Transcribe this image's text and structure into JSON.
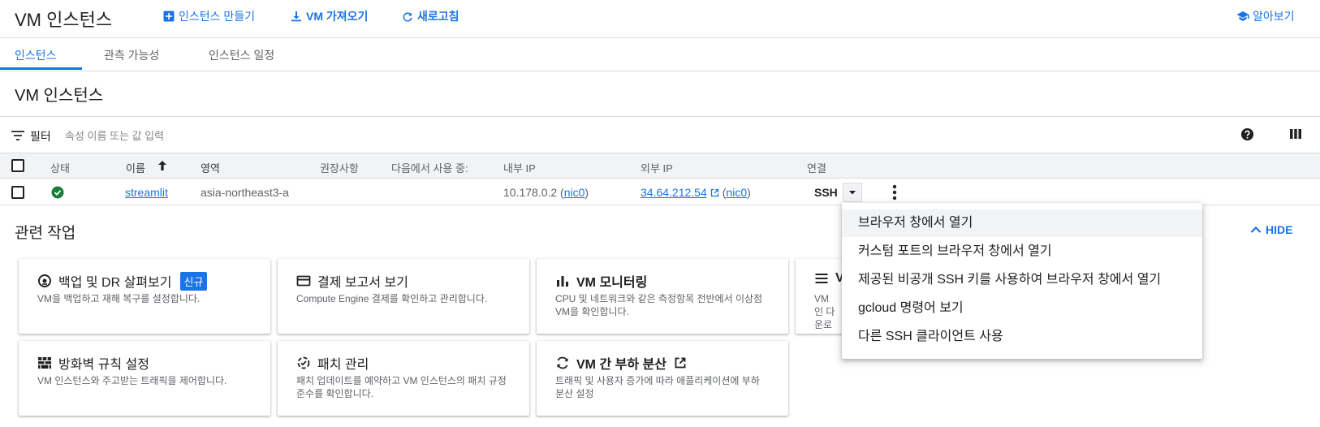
{
  "header": {
    "title": "VM 인스턴스",
    "create_label": "인스턴스 만들기",
    "import_label": "VM 가져오기",
    "refresh_label": "새로고침",
    "learn_label": "알아보기"
  },
  "tabs": [
    {
      "label": "인스턴스",
      "active": true
    },
    {
      "label": "관측 가능성",
      "active": false
    },
    {
      "label": "인스턴스 일정",
      "active": false
    }
  ],
  "section_title": "VM 인스턴스",
  "filter": {
    "label": "필터",
    "placeholder": "속성 이름 또는 값 입력"
  },
  "table": {
    "headers": {
      "status": "상태",
      "name": "이름",
      "zone": "영역",
      "recommendation": "권장사항",
      "in_use_by": "다음에서 사용 중:",
      "internal_ip": "내부 IP",
      "external_ip": "외부 IP",
      "connect": "연결"
    },
    "rows": [
      {
        "name": "streamlit",
        "zone": "asia-northeast3-a",
        "internal_ip": "10.178.0.2",
        "internal_nic": "nic0",
        "external_ip": "34.64.212.54",
        "external_nic": "nic0",
        "connect": "SSH",
        "status": "running"
      }
    ]
  },
  "related": {
    "title": "관련 작업",
    "hide_label": "HIDE",
    "cards": [
      {
        "icon": "backup-icon",
        "title": "백업 및 DR 살펴보기",
        "badge": "신규",
        "desc": "VM을 백업하고 재해 복구를 설정합니다."
      },
      {
        "icon": "billing-card-icon",
        "title": "결제 보고서 보기",
        "desc": "Compute Engine 결제를 확인하고 관리합니다."
      },
      {
        "icon": "bar-chart-icon",
        "title": "VM 모니터링",
        "desc": "CPU 및 네트워크와 같은 측정항목 전반에서 이상점 VM을 확인합니다."
      },
      {
        "icon": "list-icon",
        "title": "V",
        "desc": "VM 인 다운로"
      },
      {
        "icon": "firewall-icon",
        "title": "방화벽 규칙 설정",
        "desc": "VM 인스턴스와 주고받는 트래픽을 제어합니다."
      },
      {
        "icon": "patch-icon",
        "title": "패치 관리",
        "desc": "패치 업데이트를 예약하고 VM 인스턴스의 패치 규정 준수를 확인합니다."
      },
      {
        "icon": "load-balance-icon",
        "title": "VM 간 부하 분산",
        "desc": "트래픽 및 사용자 증가에 따라 애플리케이션에 부하 분산 설정"
      }
    ]
  },
  "ssh_menu": [
    "브라우저 창에서 열기",
    "커스텀 포트의 브라우저 창에서 열기",
    "제공된 비공개 SSH 키를 사용하여 브라우저 창에서 열기",
    "gcloud 명령어 보기",
    "다른 SSH 클라이언트 사용"
  ],
  "colors": {
    "accent": "#1a73e8",
    "status_ok": "#188038"
  }
}
